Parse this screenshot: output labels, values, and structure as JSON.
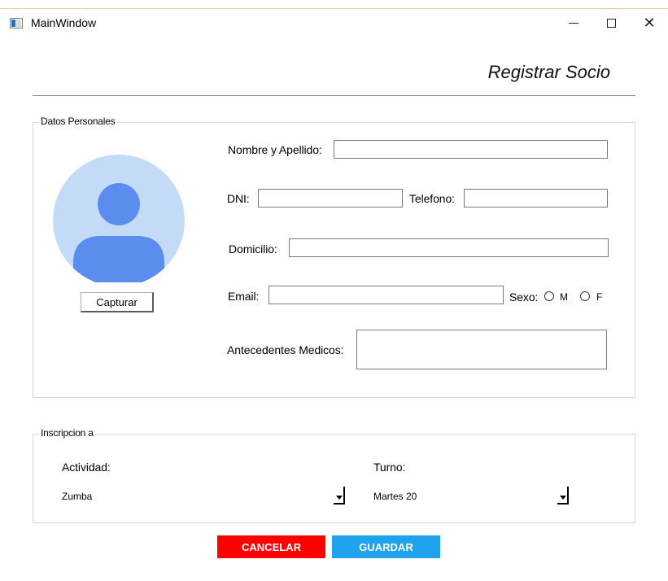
{
  "window": {
    "title": "MainWindow",
    "close_symbol": "✕"
  },
  "heading": "Registrar Socio",
  "datos_personales": {
    "title": "Datos Personales",
    "capture_button": "Capturar",
    "nombre_label": "Nombre y Apellido:",
    "nombre_value": "",
    "dni_label": "DNI:",
    "dni_value": "",
    "telefono_label": "Telefono:",
    "telefono_value": "",
    "domicilio_label": "Domicilio:",
    "domicilio_value": "",
    "email_label": "Email:",
    "email_value": "",
    "sexo_label": "Sexo:",
    "sexo_options": [
      "M",
      "F"
    ],
    "antecedentes_label": "Antecedentes Medicos:",
    "antecedentes_value": ""
  },
  "inscripcion": {
    "title": "Inscripcion a",
    "actividad_label": "Actividad:",
    "actividad_selected": "Zumba",
    "turno_label": "Turno:",
    "turno_selected": "Martes 20"
  },
  "actions": {
    "cancel_label": "CANCELAR",
    "save_label": "GUARDAR"
  },
  "colors": {
    "cancel": "#ff0000",
    "save": "#1fa3ec",
    "avatar_bg": "#c4dbf8",
    "avatar_fg": "#5b8def"
  }
}
